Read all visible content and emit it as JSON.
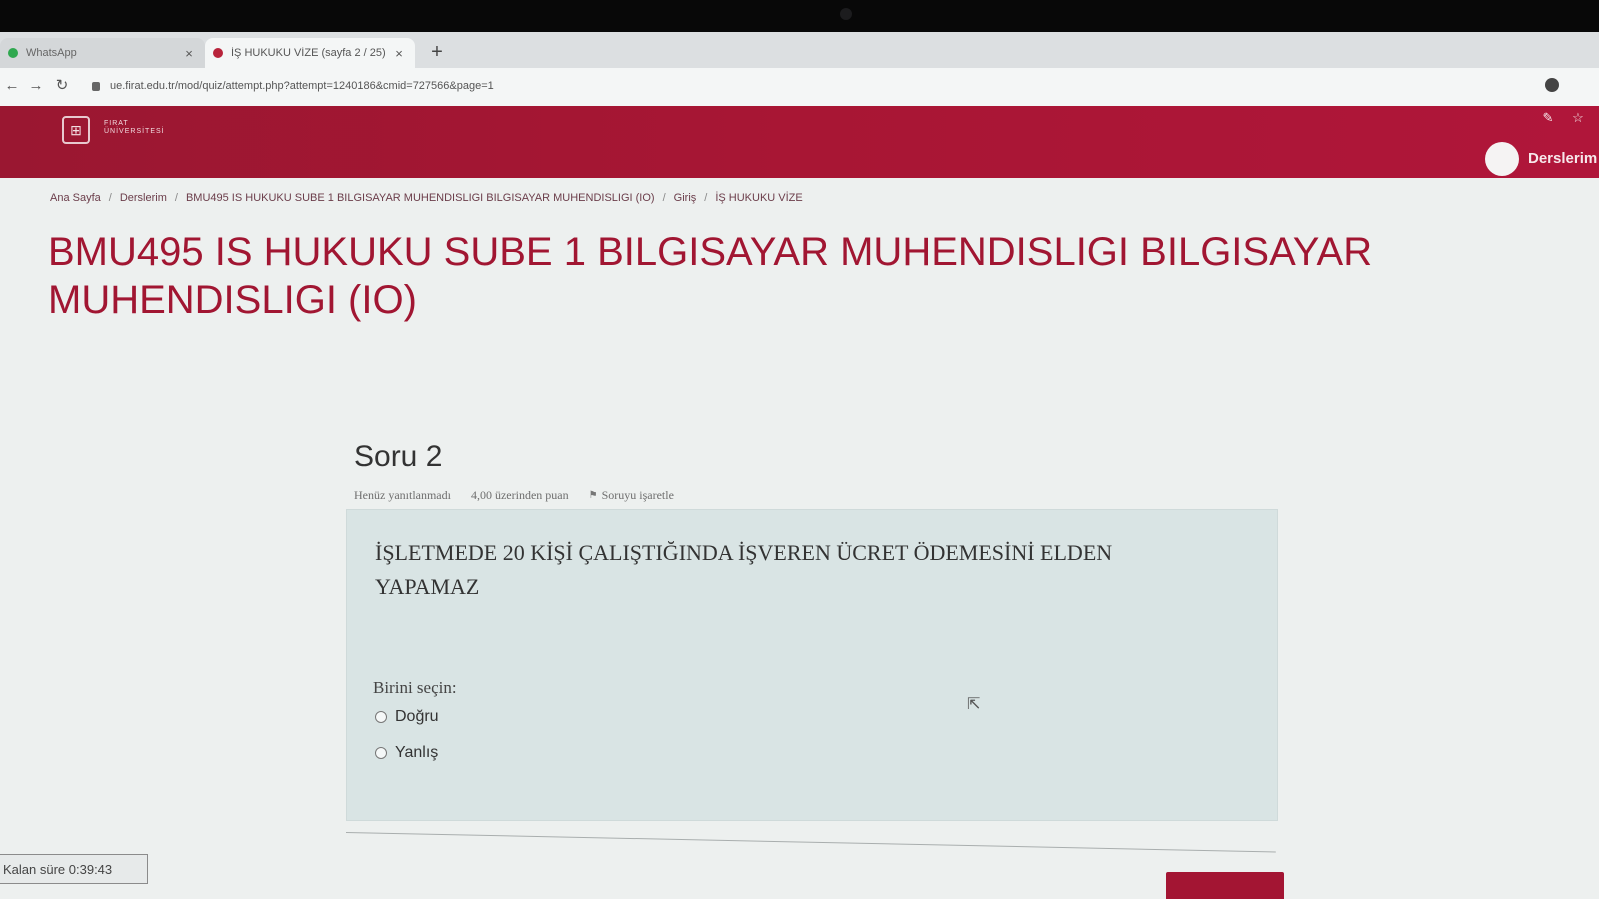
{
  "browser": {
    "tabs": [
      {
        "title": "WhatsApp",
        "active": false
      },
      {
        "title": "İŞ HUKUKU VİZE (sayfa 2 / 25)",
        "active": true
      }
    ],
    "new_tab_label": "+",
    "close_label": "×",
    "url": "ue.firat.edu.tr/mod/quiz/attempt.php?attempt=1240186&cmid=727566&page=1"
  },
  "header": {
    "logo_text": "FIRAT ÜNİVERSİTESİ",
    "my_courses_label": "Derslerim",
    "color": "#a81634"
  },
  "breadcrumb": [
    "Ana Sayfa",
    "Derslerim",
    "BMU495 IS HUKUKU SUBE 1 BILGISAYAR MUHENDISLIGI BILGISAYAR MUHENDISLIGI (IO)",
    "Giriş",
    "İŞ HUKUKU VİZE"
  ],
  "page_title": "BMU495 IS HUKUKU SUBE 1 BILGISAYAR MUHENDISLIGI BILGISAYAR MUHENDISLIGI (IO)",
  "question": {
    "number": "Soru 2",
    "status": "Henüz yanıtlanmadı",
    "grade": "4,00 üzerinden puan",
    "flag_label": "Soruyu işaretle",
    "text": "İŞLETMEDE 20 KİŞİ ÇALIŞTIĞINDA İŞVEREN ÜCRET ÖDEMESİNİ ELDEN YAPAMAZ",
    "prompt": "Birini seçin:",
    "options": [
      "Doğru",
      "Yanlış"
    ]
  },
  "timer": {
    "text": "Kalan süre 0:39:43"
  }
}
